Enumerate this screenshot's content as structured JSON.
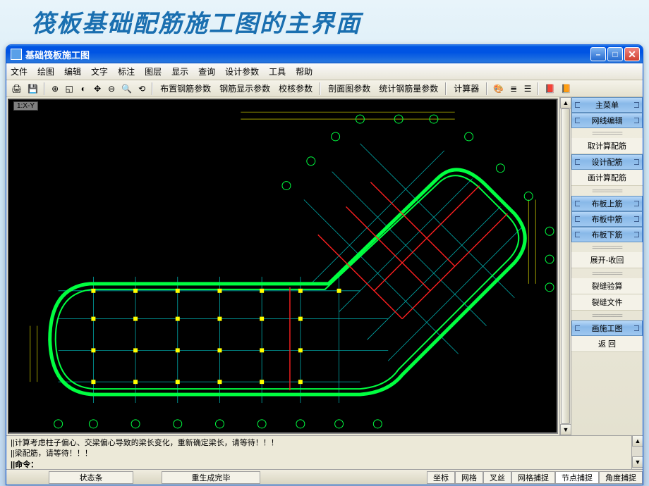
{
  "slide": {
    "title": "筏板基础配筋施工图的主界面"
  },
  "window": {
    "title": "基础筏板施工图"
  },
  "menu": {
    "m0": "文件",
    "m1": "绘图",
    "m2": "编辑",
    "m3": "文字",
    "m4": "标注",
    "m5": "图层",
    "m6": "显示",
    "m7": "查询",
    "m8": "设计参数",
    "m9": "工具",
    "m10": "帮助"
  },
  "toolbar": {
    "t1": "布置钢筋参数",
    "t2": "钢筋显示参数",
    "t3": "校核参数",
    "t4": "剖面图参数",
    "t5": "统计钢筋量参数",
    "t6": "计算器"
  },
  "canvas": {
    "viewlabel": "1:X-Y"
  },
  "side": {
    "h0": "主菜单",
    "h1": "网线编辑",
    "i1": "取计算配筋",
    "h2": "设计配筋",
    "i2": "画计算配筋",
    "h3": "布板上筋",
    "h4": "布板中筋",
    "h5": "布板下筋",
    "i3": "展开-收回",
    "i4": "裂缝验算",
    "i5": "裂缝文件",
    "h6": "画施工图",
    "i6": "返 回"
  },
  "command": {
    "l1": "||计算考虑柱子偏心、交梁偏心导致的梁长变化，重新确定梁长，请等待！！！",
    "l2": "||梁配筋，请等待！！！",
    "l3": "||命令："
  },
  "status": {
    "s1": "状态条",
    "s2": "重生成完毕",
    "s3": "坐标",
    "s4": "网格",
    "s5": "叉丝",
    "s6": "网格捕捉",
    "s7": "节点捕捉",
    "s8": "角度捕捉"
  }
}
